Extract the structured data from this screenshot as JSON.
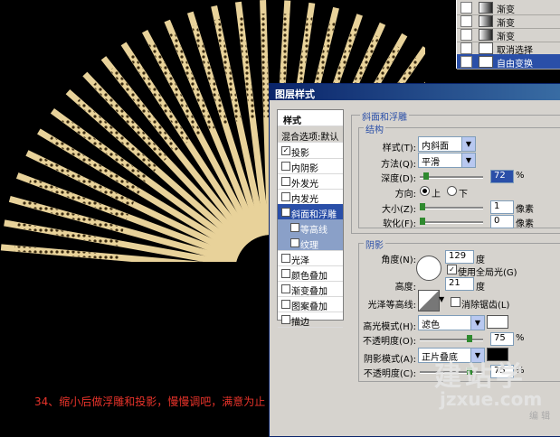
{
  "history": {
    "items": [
      {
        "label": "渐变"
      },
      {
        "label": "渐变"
      },
      {
        "label": "渐变"
      },
      {
        "label": "取消选择"
      },
      {
        "label": "自由变换"
      }
    ]
  },
  "dialog": {
    "title": "图层样式",
    "styles_header": "样式",
    "blend_options": "混合选项:默认",
    "styles": [
      {
        "label": "投影",
        "checked": "✓"
      },
      {
        "label": "内阴影",
        "checked": ""
      },
      {
        "label": "外发光",
        "checked": ""
      },
      {
        "label": "内发光",
        "checked": ""
      },
      {
        "label": "斜面和浮雕",
        "checked": "✓"
      },
      {
        "label": "等高线",
        "checked": ""
      },
      {
        "label": "纹理",
        "checked": ""
      },
      {
        "label": "光泽",
        "checked": ""
      },
      {
        "label": "颜色叠加",
        "checked": ""
      },
      {
        "label": "渐变叠加",
        "checked": ""
      },
      {
        "label": "图案叠加",
        "checked": ""
      },
      {
        "label": "描边",
        "checked": ""
      }
    ],
    "bevel": {
      "section_title": "斜面和浮雕",
      "structure_title": "结构",
      "style_label": "样式(T):",
      "style_value": "内斜面",
      "technique_label": "方法(Q):",
      "technique_value": "平滑",
      "depth_label": "深度(D):",
      "depth_value": "72",
      "depth_unit": "%",
      "direction_label": "方向:",
      "dir_up": "上",
      "dir_down": "下",
      "size_label": "大小(Z):",
      "size_value": "1",
      "size_unit": "像素",
      "soften_label": "软化(F):",
      "soften_value": "0",
      "soften_unit": "像素"
    },
    "shading": {
      "title": "阴影",
      "angle_label": "角度(N):",
      "angle_value": "129",
      "angle_unit": "度",
      "global_light_label": "使用全局光(G)",
      "altitude_label": "高度:",
      "altitude_value": "21",
      "altitude_unit": "度",
      "gloss_label": "光泽等高线:",
      "antialias_label": "消除锯齿(L)",
      "highlight_mode_label": "高光模式(H):",
      "highlight_mode_value": "滤色",
      "highlight_opacity_label": "不透明度(O):",
      "highlight_opacity_value": "75",
      "highlight_opacity_unit": "%",
      "shadow_mode_label": "阴影模式(A):",
      "shadow_mode_value": "正片叠底",
      "shadow_opacity_label": "不透明度(C):",
      "shadow_opacity_value": "75",
      "shadow_opacity_unit": "%",
      "highlight_color": "#ffffff",
      "shadow_color": "#000000"
    }
  },
  "caption": "34、缩小后做浮雕和投影，慢慢调吧，满意为止",
  "watermark": {
    "big": "建站学",
    "site": "jzxue.com",
    "small": "编 辑"
  }
}
